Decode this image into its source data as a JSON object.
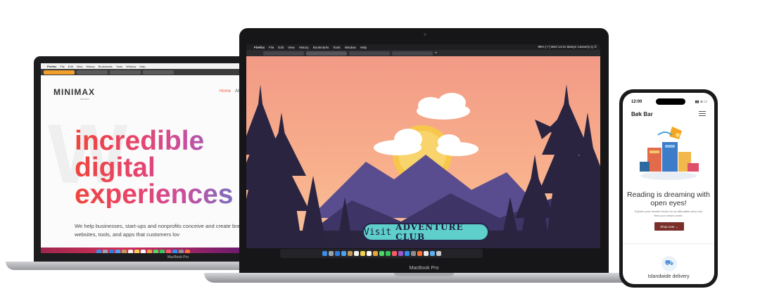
{
  "left_laptop": {
    "menubar": [
      "Firefox",
      "File",
      "Edit",
      "View",
      "History",
      "Bookmarks",
      "Tools",
      "Window",
      "Help"
    ],
    "tabs": [
      "",
      "",
      "",
      ""
    ],
    "logo": "MINIMAX",
    "logo_sub": "studios",
    "nav": {
      "home": "Home",
      "about": "Abou"
    },
    "background_letter": "W",
    "hero_lines": [
      "incredible",
      "digital",
      "experiences"
    ],
    "hero_copy": "We help businesses, start-ups and nonprofits conceive and create brands, websites, tools, and apps that customers lov",
    "model_label": "MacBook Pro"
  },
  "center_laptop": {
    "menubar": [
      "Firefox",
      "File",
      "Edit",
      "View",
      "History",
      "Bookmarks",
      "Tools",
      "Window",
      "Help"
    ],
    "menubar_right": "95% [ • ]  Wed 14:41  Martyn Casserly  Q  ☰",
    "tabs": [
      "",
      "",
      "",
      ""
    ],
    "new_tab": "+",
    "visit_word": "Visit",
    "club_name": "ADVENTURE CLUB",
    "model_label": "MacBook Pro",
    "scene_colors": {
      "sky": "#f6a58c",
      "sun": "#f7c64b",
      "mountain": "#5a4d8f",
      "trees": "#2a2440",
      "ground": "#2b2540"
    }
  },
  "phone": {
    "time": "12:00",
    "status": "▮▮ ≋ ▭",
    "logo": "Bøk Bar",
    "headline_1": "Reading is dreaming with",
    "headline_2": "open eyes!",
    "sub_1": "Explore your favorite books for an affordable price and",
    "sub_2": "feed your dream world.",
    "button": "Shop now →",
    "feature": "Islandwide delivery",
    "feature_icon": "truck-icon",
    "accent": "#7a2f2a"
  }
}
